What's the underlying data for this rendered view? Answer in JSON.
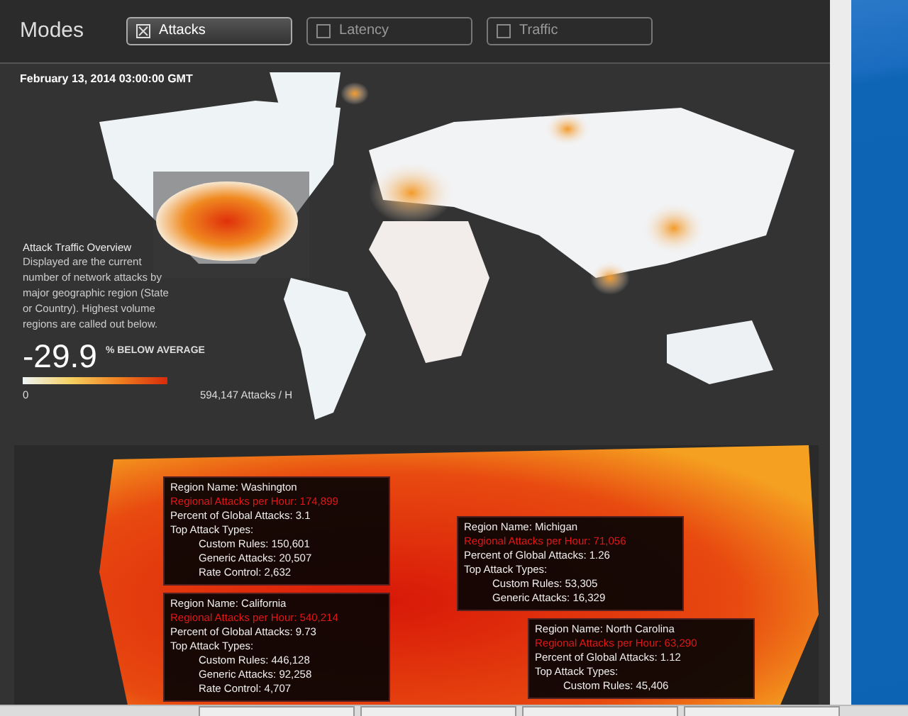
{
  "header": {
    "title": "Modes",
    "modes": [
      {
        "label": "Attacks",
        "selected": true
      },
      {
        "label": "Latency",
        "selected": false
      },
      {
        "label": "Traffic",
        "selected": false
      }
    ]
  },
  "map": {
    "timestamp": "February 13, 2014 03:00:00 GMT",
    "overview_title": "Attack Traffic Overview",
    "overview_text": "Displayed are the current number of network attacks by major geographic region (State or Country). Highest volume regions are called out below.",
    "change_value": "-29.9",
    "change_label": "% BELOW AVERAGE",
    "legend_min": "0",
    "legend_max": "594,147 Attacks / H"
  },
  "regions": [
    {
      "name": "Region Name: Washington",
      "rate": "Regional Attacks per Hour: 174,899",
      "percent": "Percent of Global Attacks: 3.1",
      "types_title": "Top Attack Types:",
      "types": [
        "Custom Rules: 150,601",
        "Generic Attacks: 20,507",
        "Rate Control: 2,632"
      ]
    },
    {
      "name": "Region Name: California",
      "rate": "Regional Attacks per Hour: 540,214",
      "percent": "Percent of Global Attacks: 9.73",
      "types_title": "Top Attack Types:",
      "types": [
        "Custom Rules: 446,128",
        "Generic Attacks: 92,258",
        "Rate Control: 4,707"
      ]
    },
    {
      "name": "Region Name: Michigan",
      "rate": "Regional Attacks per Hour: 71,056",
      "percent": "Percent of Global Attacks: 1.26",
      "types_title": "Top Attack Types:",
      "types": [
        "Custom Rules: 53,305",
        "Generic Attacks: 16,329"
      ]
    },
    {
      "name": "Region Name: North Carolina",
      "rate": "Regional Attacks per Hour: 63,290",
      "percent": "Percent of Global Attacks: 1.12",
      "types_title": "Top Attack Types:",
      "types": [
        "Custom Rules: 45,406"
      ]
    }
  ]
}
